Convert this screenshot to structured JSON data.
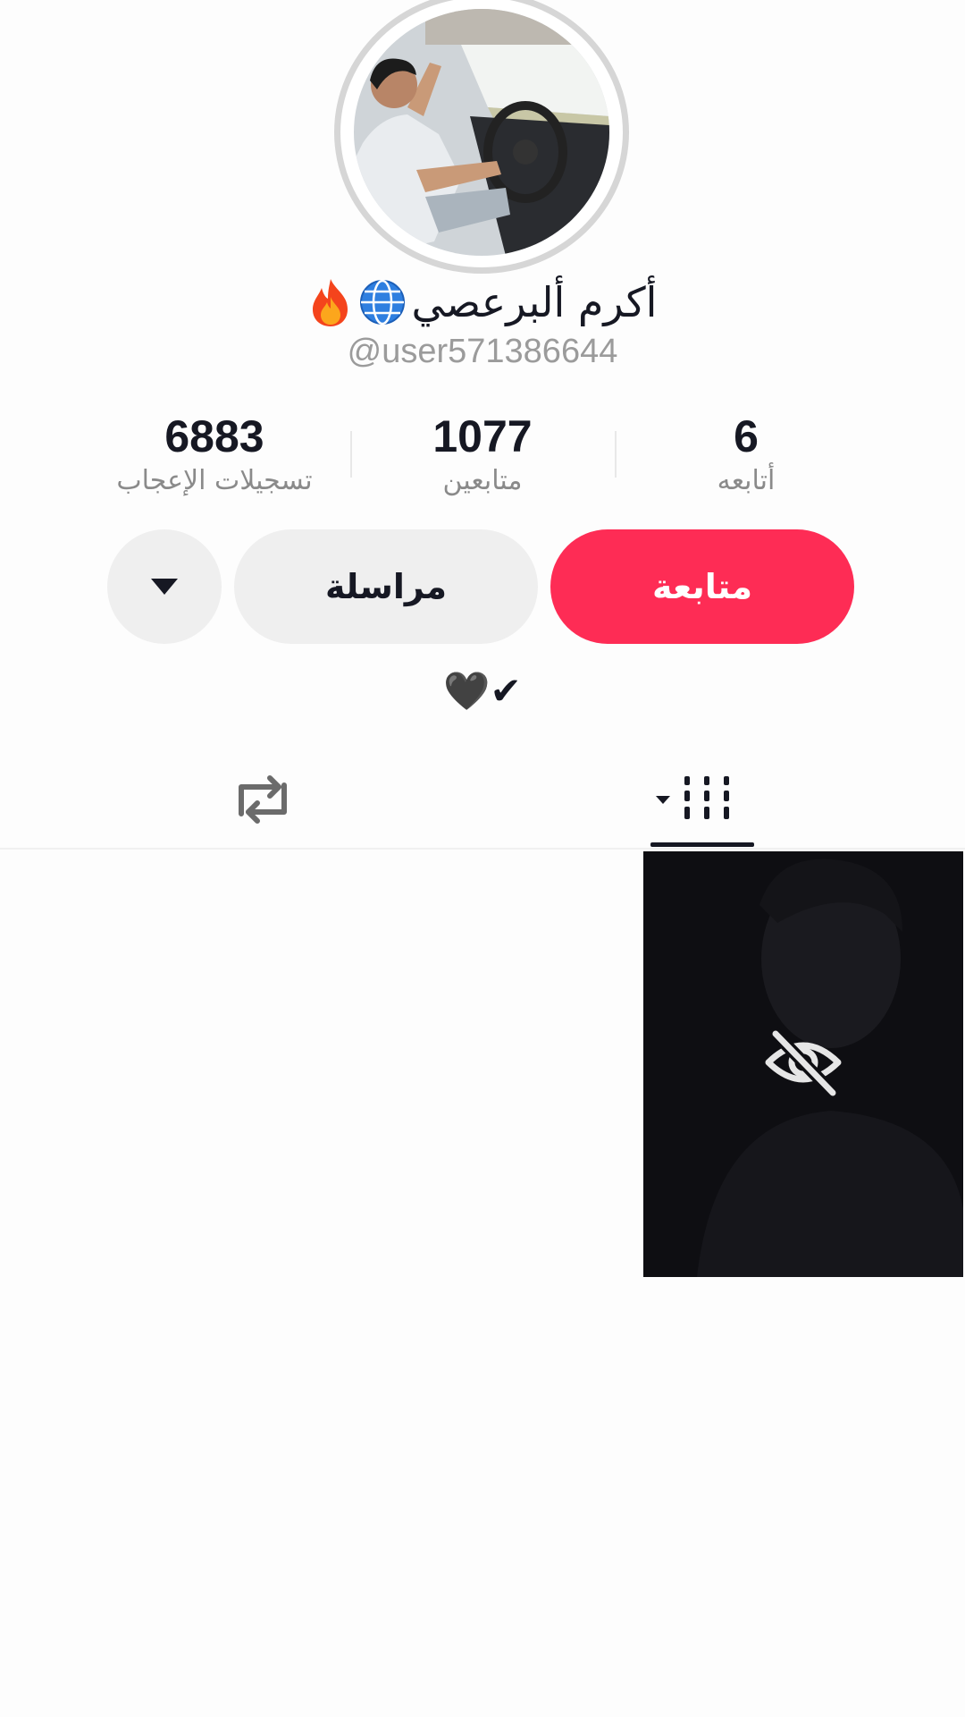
{
  "profile": {
    "display_name": "أكرم ألبرعصي",
    "name_emojis": [
      "globe-icon",
      "fire-icon"
    ],
    "handle": "@user571386644",
    "bio": "🖤✔"
  },
  "stats": {
    "following": {
      "value": "6",
      "label": "أتابعه"
    },
    "followers": {
      "value": "1077",
      "label": "متابعين"
    },
    "likes": {
      "value": "6883",
      "label": "تسجيلات الإعجاب"
    }
  },
  "actions": {
    "follow_label": "متابعة",
    "message_label": "مراسلة"
  },
  "tabs": {
    "videos": "grid-icon",
    "reposts": "repost-icon"
  },
  "colors": {
    "accent": "#fe2c55",
    "text": "#161823",
    "muted": "#8a8a8a",
    "button_bg": "#efefef"
  }
}
